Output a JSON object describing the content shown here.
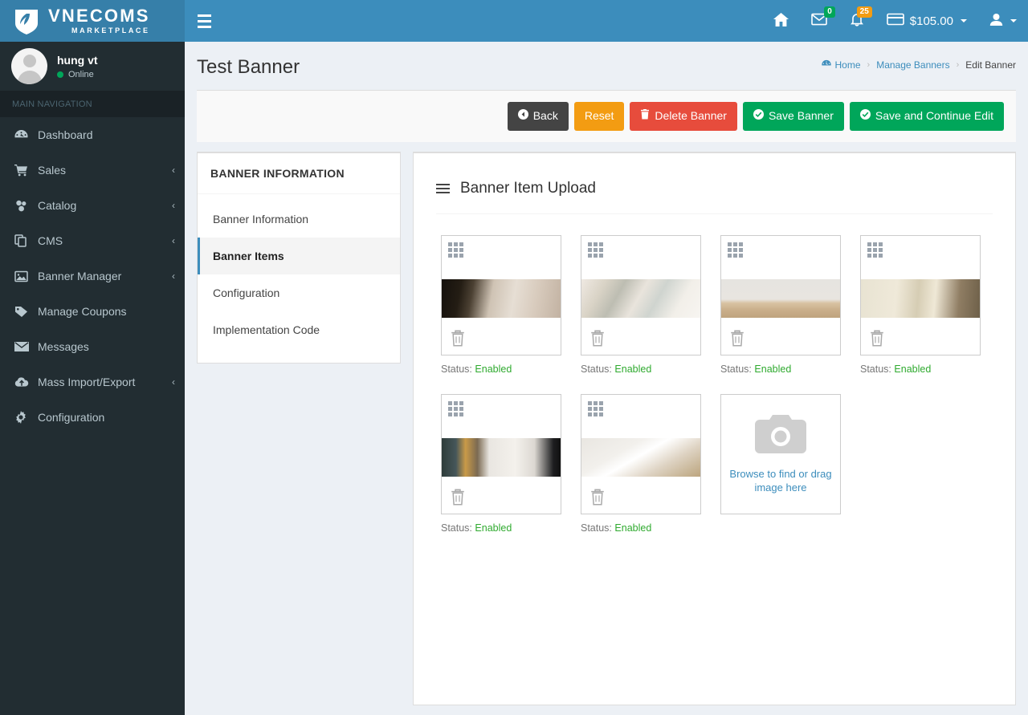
{
  "brand": {
    "name": "VNECOMS",
    "tagline": "MARKETPLACE",
    "logo_icon": "leaf-shield-logo"
  },
  "topbar": {
    "menu_toggle_icon": "hamburger-icon",
    "home_icon": "home-icon",
    "messages_icon": "envelope-icon",
    "messages_count": "0",
    "notifications_icon": "bell-icon",
    "notifications_count": "25",
    "wallet_icon": "credit-card-icon",
    "balance": "$105.00",
    "user_icon": "user-icon"
  },
  "sidebar": {
    "user": {
      "name": "hung vt",
      "status": "Online",
      "avatar_icon": "avatar-placeholder-icon"
    },
    "nav_header": "MAIN NAVIGATION",
    "items": [
      {
        "label": "Dashboard",
        "icon": "dashboard-icon",
        "arrow": ""
      },
      {
        "label": "Sales",
        "icon": "cart-icon",
        "arrow": "‹"
      },
      {
        "label": "Catalog",
        "icon": "sitemap-icon",
        "arrow": "‹"
      },
      {
        "label": "CMS",
        "icon": "copy-icon",
        "arrow": "‹"
      },
      {
        "label": "Banner Manager",
        "icon": "image-icon",
        "arrow": "‹"
      },
      {
        "label": "Manage Coupons",
        "icon": "tag-icon",
        "arrow": ""
      },
      {
        "label": "Messages",
        "icon": "envelope-icon",
        "arrow": ""
      },
      {
        "label": "Mass Import/Export",
        "icon": "cloud-upload-icon",
        "arrow": "‹"
      },
      {
        "label": "Configuration",
        "icon": "gear-icon",
        "arrow": ""
      }
    ]
  },
  "header": {
    "title": "Test Banner",
    "breadcrumb": {
      "home_icon": "dashboard-icon",
      "home": "Home",
      "sep": "›",
      "parent": "Manage Banners",
      "current": "Edit Banner"
    }
  },
  "toolbar": {
    "back": "Back",
    "reset": "Reset",
    "delete": "Delete Banner",
    "save": "Save Banner",
    "save_continue": "Save and Continue Edit"
  },
  "tabs": {
    "card_title": "BANNER INFORMATION",
    "items": [
      {
        "label": "Banner Information",
        "active": false
      },
      {
        "label": "Banner Items",
        "active": true
      },
      {
        "label": "Configuration",
        "active": false
      },
      {
        "label": "Implementation Code",
        "active": false
      }
    ]
  },
  "panel": {
    "title": "Banner Item Upload",
    "title_icon": "bars-icon",
    "status_label": "Status:",
    "items": [
      {
        "status": "Enabled",
        "drag_icon": "grid-drag-handle-icon",
        "delete_icon": "trash-icon",
        "thumb": "desk-plant-frame"
      },
      {
        "status": "Enabled",
        "drag_icon": "grid-drag-handle-icon",
        "delete_icon": "trash-icon",
        "thumb": "bright-shelf-decor"
      },
      {
        "status": "Enabled",
        "drag_icon": "grid-drag-handle-icon",
        "delete_icon": "trash-icon",
        "thumb": "desk-lamp-table"
      },
      {
        "status": "Enabled",
        "drag_icon": "grid-drag-handle-icon",
        "delete_icon": "trash-icon",
        "thumb": "notebook-dried-flowers"
      },
      {
        "status": "Enabled",
        "drag_icon": "grid-drag-handle-icon",
        "delete_icon": "trash-icon",
        "thumb": "storefront-night"
      },
      {
        "status": "Enabled",
        "drag_icon": "grid-drag-handle-icon",
        "delete_icon": "trash-icon",
        "thumb": "mugs-on-desk"
      }
    ],
    "uploader": {
      "icon": "camera-icon",
      "text": "Browse to find or drag image here"
    }
  },
  "colors": {
    "brand_blue": "#3c8dbc",
    "brand_blue_dark": "#367fa9",
    "sidebar": "#222d32",
    "green": "#00a65a",
    "orange": "#f39c12",
    "red": "#e74c3c",
    "dark": "#444444",
    "status_green": "#2faa2f",
    "page_bg": "#ecf0f5"
  }
}
